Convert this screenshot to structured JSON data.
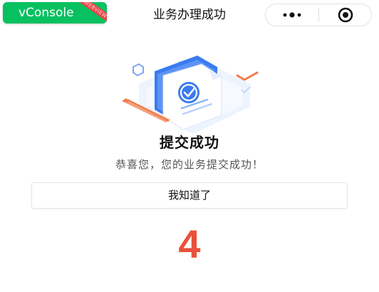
{
  "vconsole": {
    "label": "vConsole",
    "ribbon": "WEBVIEW"
  },
  "navbar": {
    "title": "业务办理成功",
    "more_icon": "more-dots-icon",
    "close_icon": "capsule-close-icon"
  },
  "result": {
    "icon": "document-check-illustration",
    "title": "提交成功",
    "description": "恭喜您，您的业务提交成功！",
    "button_label": "我知道了",
    "countdown": "4"
  },
  "colors": {
    "vconsole_green": "#07c160",
    "countdown_red": "#e8513b",
    "illustration_blue": "#3b7bf0",
    "accent_orange": "#f07a4a"
  }
}
